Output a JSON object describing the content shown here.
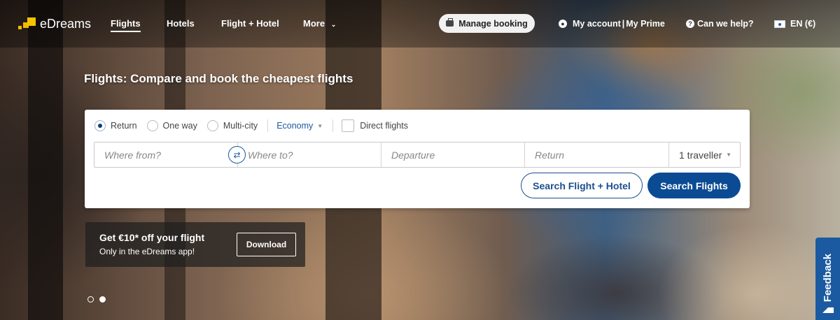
{
  "nav": {
    "logo_text": "eDreams",
    "items": [
      {
        "label": "Flights"
      },
      {
        "label": "Hotels"
      },
      {
        "label": "Flight + Hotel"
      },
      {
        "label": "More"
      }
    ],
    "manage_booking": "Manage booking",
    "my_account": "My account",
    "my_prime": "My Prime",
    "help": "Can we help?",
    "language": "EN (€)"
  },
  "hero": {
    "title": "Flights: Compare and book the cheapest flights"
  },
  "search": {
    "trip_types": [
      {
        "label": "Return",
        "checked": true
      },
      {
        "label": "One way",
        "checked": false
      },
      {
        "label": "Multi-city",
        "checked": false
      }
    ],
    "cabin_class": "Economy",
    "direct_flights_label": "Direct flights",
    "from_placeholder": "Where from?",
    "to_placeholder": "Where to?",
    "departure_placeholder": "Departure",
    "return_placeholder": "Return",
    "travellers": "1 traveller",
    "flight_hotel_button": "Search Flight + Hotel",
    "search_button": "Search Flights"
  },
  "promo": {
    "title": "Get €10* off your flight",
    "subtitle": "Only in the eDreams app!",
    "button": "Download"
  },
  "feedback_label": "Feedback",
  "colors": {
    "primary": "#0b4b94",
    "accent": "#1b5aa0",
    "logo": "#f5c400"
  }
}
